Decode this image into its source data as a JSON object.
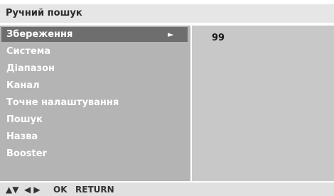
{
  "window": {
    "title": "Ручний пошук"
  },
  "menu": {
    "items": [
      {
        "label": "Збереження",
        "selected": true
      },
      {
        "label": "Система"
      },
      {
        "label": "Діапазон"
      },
      {
        "label": "Канал"
      },
      {
        "label": "Точне налаштування"
      },
      {
        "label": "Пошук"
      },
      {
        "label": "Назва"
      },
      {
        "label": "Booster"
      }
    ],
    "submenu_arrow_icon": "triangle-right-icon"
  },
  "value_panel": {
    "value": "99"
  },
  "footer": {
    "nav_updown": "▲▼",
    "nav_leftright": "◀ ▶",
    "ok_label": "OK",
    "return_label": "RETURN"
  },
  "colors": {
    "title_bar": "#e6e6e6",
    "menu_panel": "#b4b4b4",
    "selected_row": "#6e6e6e",
    "value_panel": "#c8c8c8"
  }
}
